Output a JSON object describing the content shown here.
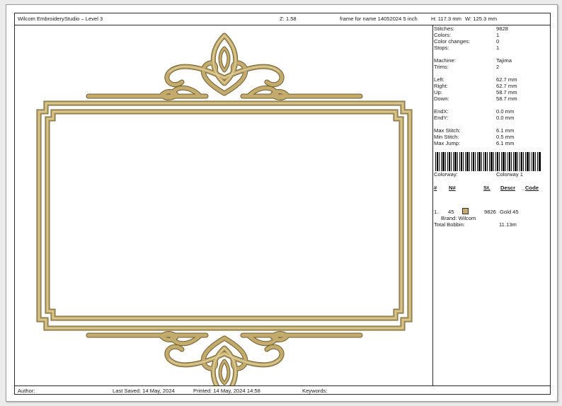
{
  "header": {
    "app_title": "Wilcom EmbroideryStudio – Level 3",
    "zoom": "Z: 1.58",
    "design_name": "frame for name 14052024 5 inch",
    "height": "H: 117.3 mm",
    "width": "W: 125.3 mm"
  },
  "stats": [
    {
      "label": "Stitches:",
      "value": "9828"
    },
    {
      "label": "Colors:",
      "value": "1"
    },
    {
      "label": "Color changes:",
      "value": "0"
    },
    {
      "label": "Stops:",
      "value": "1"
    },
    {
      "label": "Machine:",
      "value": "Tajima"
    },
    {
      "label": "Trims:",
      "value": "2"
    },
    {
      "label": "Left:",
      "value": "62.7 mm"
    },
    {
      "label": "Right:",
      "value": "62.7 mm"
    },
    {
      "label": "Up:",
      "value": "58.7 mm"
    },
    {
      "label": "Down:",
      "value": "58.7 mm"
    },
    {
      "label": "EndX:",
      "value": "0.0 mm"
    },
    {
      "label": "EndY:",
      "value": "0.0 mm"
    },
    {
      "label": "Max Stitch:",
      "value": "6.1 mm"
    },
    {
      "label": "Min Stitch:",
      "value": "0.5 mm"
    },
    {
      "label": "Max Jump:",
      "value": "6.1 mm"
    }
  ],
  "colorway": {
    "label": "Colorway:",
    "value": "Colorway 1"
  },
  "color_table": {
    "headers": {
      "num": "#",
      "n": "N#",
      "st": "St.",
      "descr": "Descr",
      "code": "Code"
    },
    "rows": [
      {
        "index": "1.",
        "n": "45",
        "stitches": "9826",
        "descr": "Gold 45",
        "brand": "Brand: Wilcom",
        "swatch_color": "#c2ab6c"
      }
    ],
    "total_bobbin_label": "Total Bobbin:",
    "total_bobbin_value": "11.13m"
  },
  "footer": {
    "author": "Author:",
    "last_saved": "Last Saved: 14 May, 2024",
    "printed": "Printed: 14 May, 2024 14:58",
    "keywords": "Keywords:"
  },
  "colors": {
    "thread_gold": "#c2ab6c",
    "thread_dark": "#6f5f30",
    "thread_light": "#e3d5a6"
  }
}
